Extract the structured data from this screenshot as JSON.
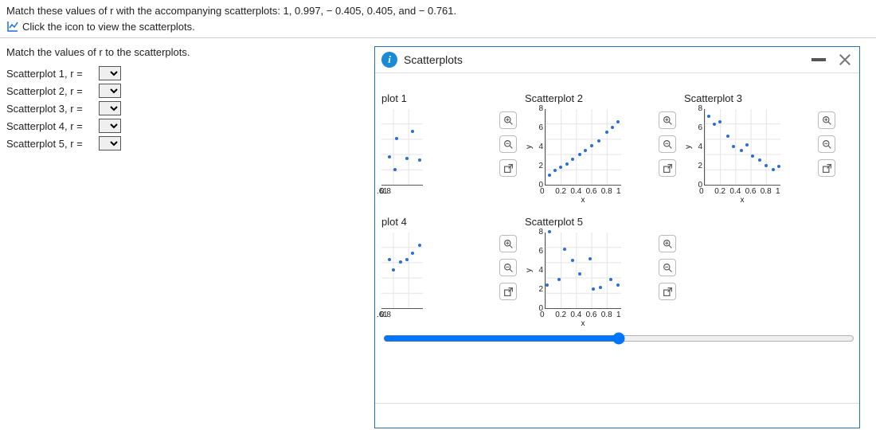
{
  "question": {
    "line1": "Match these values of r with the accompanying scatterplots: 1, 0.997, − 0.405, 0.405, and − 0.761.",
    "link_text": "Click the icon to view the scatterplots."
  },
  "instruction": "Match the values of r to the scatterplots.",
  "rows": [
    {
      "label": "Scatterplot 1, r ="
    },
    {
      "label": "Scatterplot 2, r ="
    },
    {
      "label": "Scatterplot 3, r ="
    },
    {
      "label": "Scatterplot 4, r ="
    },
    {
      "label": "Scatterplot 5, r ="
    }
  ],
  "dialog": {
    "title": "Scatterplots",
    "plots": {
      "p1_title": "plot 1",
      "p2_title": "Scatterplot 2",
      "p3_title": "Scatterplot 3",
      "p4_title": "plot 4",
      "p5_title": "Scatterplot 5"
    },
    "xticks_full": [
      "0",
      "0.2",
      "0.4",
      "0.6",
      "0.8",
      "1"
    ],
    "xticks_clipped": [
      ".6",
      "0.8",
      "1"
    ],
    "yticks": [
      "8",
      "6",
      "4",
      "2",
      "0"
    ],
    "xlabel": "x",
    "ylabel": "y"
  },
  "chart_data": [
    {
      "id": "plot1",
      "type": "scatter",
      "xlim": [
        0,
        1
      ],
      "ylim": [
        0,
        10
      ],
      "title": "plot 1",
      "xlabel": "x",
      "ylabel": "y",
      "points": [
        [
          0.55,
          3.6
        ],
        [
          0.62,
          2.0
        ],
        [
          0.65,
          6.0
        ],
        [
          0.78,
          3.4
        ],
        [
          0.85,
          7.0
        ],
        [
          0.95,
          3.2
        ]
      ]
    },
    {
      "id": "plot2",
      "type": "scatter",
      "xlim": [
        0,
        1
      ],
      "ylim": [
        0,
        8
      ],
      "title": "Scatterplot 2",
      "xlabel": "x",
      "ylabel": "y",
      "points": [
        [
          0.05,
          1.0
        ],
        [
          0.12,
          1.5
        ],
        [
          0.2,
          1.8
        ],
        [
          0.28,
          2.2
        ],
        [
          0.35,
          2.7
        ],
        [
          0.45,
          3.2
        ],
        [
          0.52,
          3.6
        ],
        [
          0.6,
          4.1
        ],
        [
          0.7,
          4.6
        ],
        [
          0.8,
          5.5
        ],
        [
          0.88,
          6.0
        ],
        [
          0.95,
          6.6
        ]
      ]
    },
    {
      "id": "plot3",
      "type": "scatter",
      "xlim": [
        0,
        1
      ],
      "ylim": [
        0,
        8
      ],
      "title": "Scatterplot 3",
      "xlabel": "x",
      "ylabel": "y",
      "points": [
        [
          0.05,
          7.2
        ],
        [
          0.12,
          6.3
        ],
        [
          0.2,
          6.6
        ],
        [
          0.3,
          5.1
        ],
        [
          0.38,
          4.0
        ],
        [
          0.48,
          3.6
        ],
        [
          0.55,
          4.2
        ],
        [
          0.63,
          3.0
        ],
        [
          0.72,
          2.6
        ],
        [
          0.8,
          2.0
        ],
        [
          0.9,
          1.6
        ],
        [
          0.97,
          1.9
        ]
      ]
    },
    {
      "id": "plot4",
      "type": "scatter",
      "xlim": [
        0,
        1
      ],
      "ylim": [
        0,
        10
      ],
      "title": "plot 4",
      "xlabel": "x",
      "ylabel": "y",
      "points": [
        [
          0.55,
          6.4
        ],
        [
          0.6,
          5.0
        ],
        [
          0.7,
          6.0
        ],
        [
          0.78,
          6.4
        ],
        [
          0.85,
          7.2
        ],
        [
          0.95,
          8.2
        ]
      ]
    },
    {
      "id": "plot5",
      "type": "scatter",
      "xlim": [
        0,
        1
      ],
      "ylim": [
        0,
        8
      ],
      "title": "Scatterplot 5",
      "xlabel": "x",
      "ylabel": "y",
      "points": [
        [
          0.02,
          2.4
        ],
        [
          0.05,
          8.0
        ],
        [
          0.18,
          3.0
        ],
        [
          0.25,
          6.2
        ],
        [
          0.35,
          5.0
        ],
        [
          0.45,
          3.6
        ],
        [
          0.58,
          5.2
        ],
        [
          0.62,
          2.0
        ],
        [
          0.72,
          2.2
        ],
        [
          0.85,
          3.0
        ],
        [
          0.95,
          2.4
        ]
      ]
    }
  ]
}
